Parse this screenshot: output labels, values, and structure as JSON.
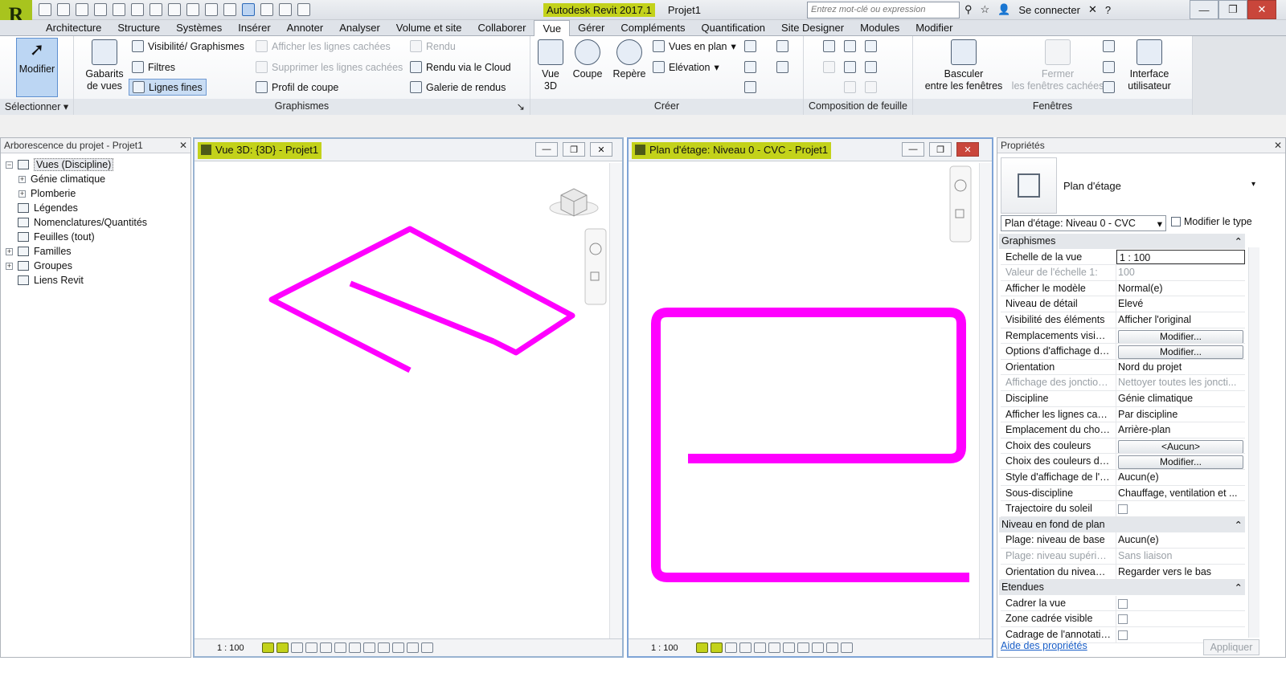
{
  "app": {
    "logo": "R",
    "title": "Autodesk Revit 2017.1",
    "project": "Projet1",
    "search_placeholder": "Entrez mot-clé ou expression",
    "signin": "Se connecter",
    "help": "?",
    "colors": {
      "highlight": "#c3d21a",
      "pipe": "#ff00ff",
      "close_red": "#c9463b"
    }
  },
  "tabs": [
    "Architecture",
    "Structure",
    "Systèmes",
    "Insérer",
    "Annoter",
    "Analyser",
    "Volume et site",
    "Collaborer",
    "Vue",
    "Gérer",
    "Compléments",
    "Quantification",
    "Site Designer",
    "Modules",
    "Modifier"
  ],
  "ribbon": {
    "modifier": "Modifier",
    "select_label": "Sélectionner",
    "graphismes": {
      "label": "Graphismes",
      "gabarits_l1": "Gabarits",
      "gabarits_l2": "de vues",
      "visibilite": "Visibilité/ Graphismes",
      "filtres": "Filtres",
      "lignes_fines": "Lignes fines",
      "afficher_lignes": "Afficher les lignes cachées",
      "supprimer_lignes": "Supprimer les lignes cachées",
      "profil": "Profil de coupe",
      "rendu": "Rendu",
      "rendu_cloud": "Rendu  via le Cloud",
      "galerie": "Galerie  de rendus"
    },
    "creer": {
      "label": "Créer",
      "vue3d_l1": "Vue",
      "vue3d_l2": "3D",
      "coupe": "Coupe",
      "repere": "Repère",
      "vues_plan": "Vues en plan",
      "elevation": "Elévation"
    },
    "composition": {
      "label": "Composition de feuille"
    },
    "fenetres": {
      "label": "Fenêtres",
      "basculer_l1": "Basculer",
      "basculer_l2": "entre les fenêtres",
      "fermer_l1": "Fermer",
      "fermer_l2": "les fenêtres cachées",
      "interface_l1": "Interface",
      "interface_l2": "utilisateur"
    }
  },
  "browser": {
    "title": "Arborescence du projet - Projet1",
    "items": [
      {
        "label": "Vues (Discipline)",
        "expand": "−"
      },
      {
        "label": "Génie climatique",
        "expand": "+"
      },
      {
        "label": "Plomberie",
        "expand": "+"
      },
      {
        "label": "Légendes",
        "expand": ""
      },
      {
        "label": "Nomenclatures/Quantités",
        "expand": ""
      },
      {
        "label": "Feuilles (tout)",
        "expand": ""
      },
      {
        "label": "Familles",
        "expand": "+"
      },
      {
        "label": "Groupes",
        "expand": "+"
      },
      {
        "label": "Liens Revit",
        "expand": ""
      }
    ]
  },
  "view3d": {
    "title": "Vue 3D: {3D} - Projet1",
    "scale": "1 : 100"
  },
  "viewplan": {
    "title": "Plan d'étage: Niveau 0 - CVC - Projet1",
    "scale": "1 : 100"
  },
  "props": {
    "title": "Propriétés",
    "type_name": "Plan d'étage",
    "selector": "Plan d'étage: Niveau 0 - CVC",
    "modifier_type": "Modifier le type",
    "groups": {
      "graphismes": "Graphismes",
      "niveau": "Niveau en fond de plan",
      "etendues": "Etendues"
    },
    "rows": [
      {
        "k": "Echelle de la vue",
        "v": "1 : 100"
      },
      {
        "k": "Valeur de l'échelle    1:",
        "v": "100"
      },
      {
        "k": "Afficher le modèle",
        "v": "Normal(e)"
      },
      {
        "k": "Niveau de détail",
        "v": "Elevé"
      },
      {
        "k": "Visibilité des éléments",
        "v": "Afficher l'original"
      },
      {
        "k": "Remplacements visibilit...",
        "v": "Modifier..."
      },
      {
        "k": "Options d'affichage des...",
        "v": "Modifier..."
      },
      {
        "k": "Orientation",
        "v": "Nord du projet"
      },
      {
        "k": "Affichage des jonctions ...",
        "v": "Nettoyer toutes les joncti..."
      },
      {
        "k": "Discipline",
        "v": "Génie climatique"
      },
      {
        "k": "Afficher les lignes caché...",
        "v": "Par discipline"
      },
      {
        "k": "Emplacement du choix ...",
        "v": "Arrière-plan"
      },
      {
        "k": "Choix des couleurs",
        "v": "<Aucun>"
      },
      {
        "k": "Choix des couleurs du s...",
        "v": "Modifier..."
      },
      {
        "k": "Style d'affichage de l'an...",
        "v": "Aucun(e)"
      },
      {
        "k": "Sous-discipline",
        "v": "Chauffage, ventilation et ..."
      },
      {
        "k": "Trajectoire du soleil",
        "v": ""
      },
      {
        "k": "Plage: niveau de base",
        "v": "Aucun(e)"
      },
      {
        "k": "Plage: niveau supérieur",
        "v": "Sans liaison"
      },
      {
        "k": "Orientation du niveau e...",
        "v": "Regarder vers le bas"
      },
      {
        "k": "Cadrer la vue",
        "v": ""
      },
      {
        "k": "Zone cadrée visible",
        "v": ""
      },
      {
        "k": "Cadrage de l'annotation",
        "v": ""
      }
    ],
    "help_link": "Aide des propriétés",
    "apply": "Appliquer"
  }
}
